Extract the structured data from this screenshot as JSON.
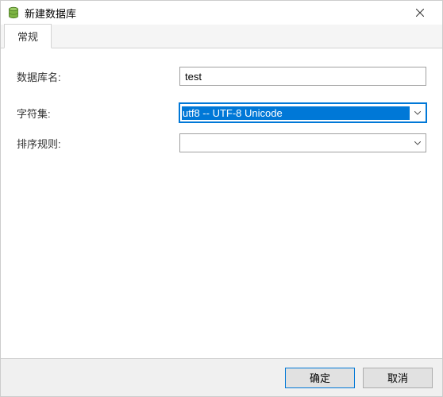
{
  "window": {
    "title": "新建数据库"
  },
  "tabs": {
    "general": "常规"
  },
  "form": {
    "db_name_label": "数据库名:",
    "db_name_value": "test",
    "charset_label": "字符集:",
    "charset_value": "utf8 -- UTF-8 Unicode",
    "collation_label": "排序规则:",
    "collation_value": ""
  },
  "buttons": {
    "ok": "确定",
    "cancel": "取消"
  }
}
